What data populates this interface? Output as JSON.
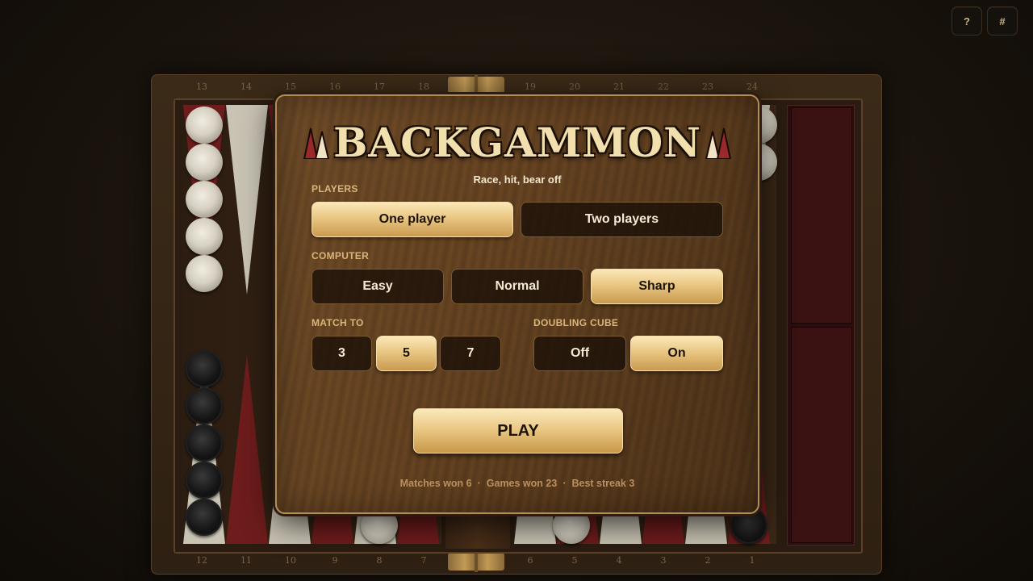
{
  "corner_buttons": {
    "help": "?",
    "hash": "#"
  },
  "board": {
    "top_numbers": [
      "13",
      "14",
      "15",
      "16",
      "17",
      "18",
      "19",
      "20",
      "21",
      "22",
      "23",
      "24"
    ],
    "bottom_numbers": [
      "12",
      "11",
      "10",
      "9",
      "8",
      "7",
      "6",
      "5",
      "4",
      "3",
      "2",
      "1"
    ]
  },
  "modal": {
    "title": "BACKGAMMON",
    "subtitle": "Race, hit, bear off",
    "players": {
      "label": "PLAYERS",
      "options": [
        {
          "label": "One player",
          "selected": true
        },
        {
          "label": "Two players",
          "selected": false
        }
      ]
    },
    "computer": {
      "label": "COMPUTER",
      "options": [
        {
          "label": "Easy",
          "selected": false
        },
        {
          "label": "Normal",
          "selected": false
        },
        {
          "label": "Sharp",
          "selected": true
        }
      ]
    },
    "match_to": {
      "label": "MATCH TO",
      "options": [
        {
          "label": "3",
          "selected": false
        },
        {
          "label": "5",
          "selected": true
        },
        {
          "label": "7",
          "selected": false
        }
      ]
    },
    "doubling_cube": {
      "label": "DOUBLING CUBE",
      "options": [
        {
          "label": "Off",
          "selected": false
        },
        {
          "label": "On",
          "selected": true
        }
      ]
    },
    "play_label": "PLAY",
    "stats": {
      "matches_won": "Matches won 6",
      "games_won": "Games won 23",
      "best_streak": "Best streak 3",
      "separator": "·"
    }
  },
  "colors": {
    "accent_gold": "#e9c783",
    "wood_dark": "#5a3b1d",
    "point_red": "#6e1c1c",
    "point_ivory": "#c9c3b4"
  }
}
